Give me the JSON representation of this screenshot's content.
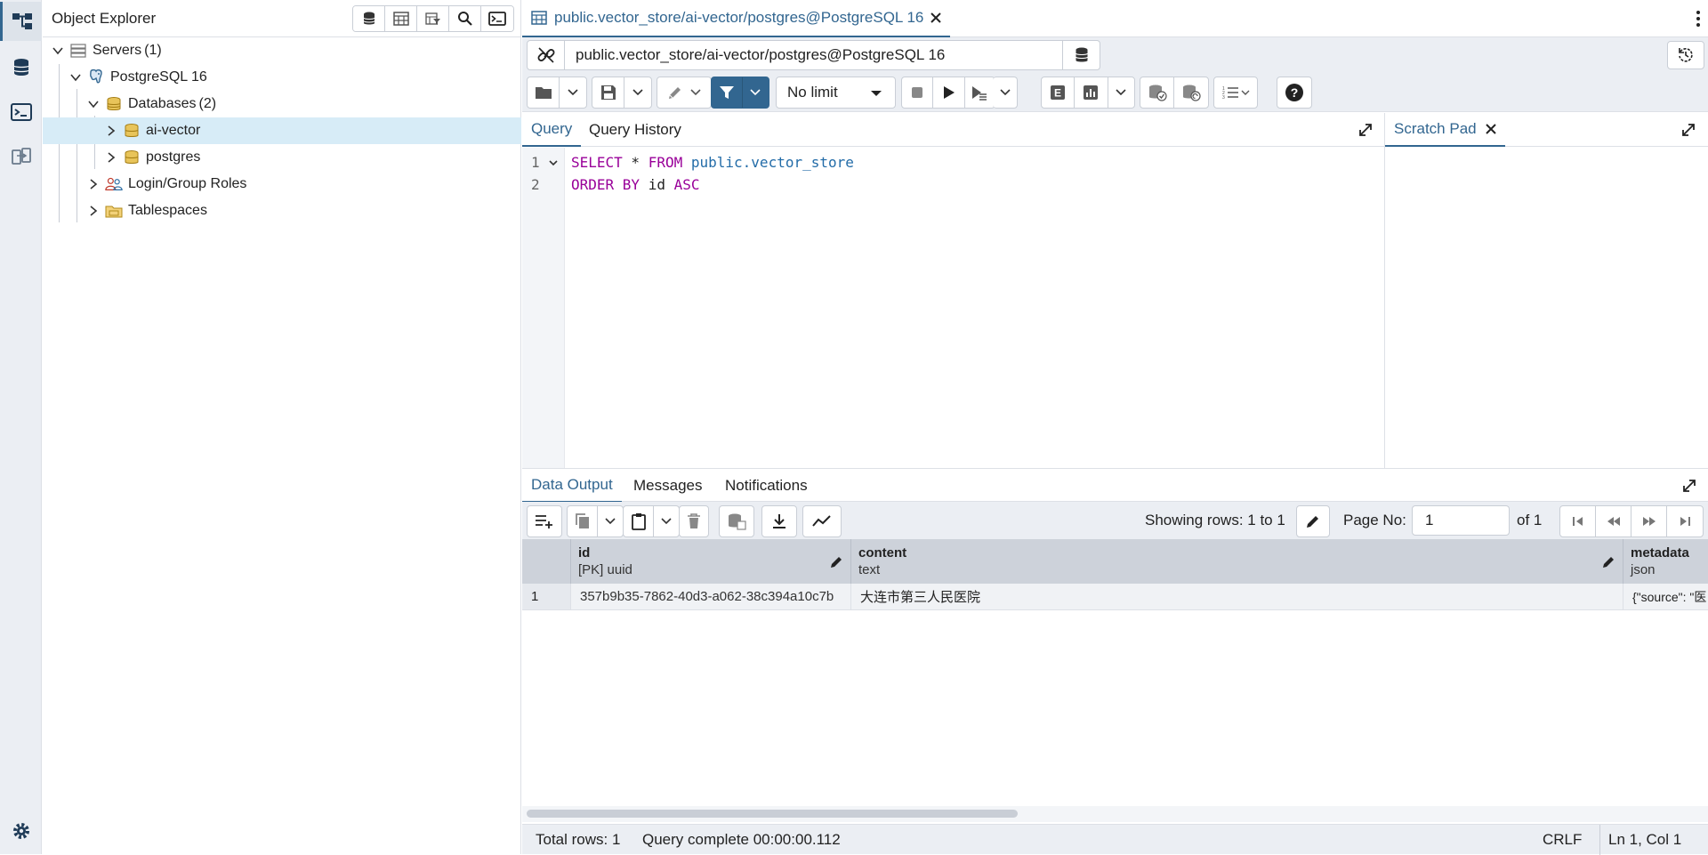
{
  "rail": {
    "items": [
      "object-explorer",
      "database",
      "terminal",
      "schema-diff",
      "settings"
    ]
  },
  "explorer": {
    "title": "Object Explorer",
    "tools": [
      "database-icon",
      "table-icon",
      "filter-table-icon",
      "search-icon",
      "terminal-icon"
    ],
    "tree": {
      "servers": "Servers",
      "servers_count": "(1)",
      "server": "PostgreSQL 16",
      "databases": "Databases",
      "databases_count": "(2)",
      "db1": "ai-vector",
      "db2": "postgres",
      "roles": "Login/Group Roles",
      "tablespaces": "Tablespaces"
    }
  },
  "main": {
    "tab_title": "public.vector_store/ai-vector/postgres@PostgreSQL 16",
    "connection": "public.vector_store/ai-vector/postgres@PostgreSQL 16",
    "limit": "No limit",
    "query_tabs": [
      "Query",
      "Query History"
    ],
    "scratch_pad": "Scratch Pad",
    "editor": {
      "line1_num": "1",
      "line2_num": "2",
      "line1": {
        "kw1": "SELECT",
        "star": " * ",
        "kw2": "FROM",
        "table": " public.vector_store"
      },
      "line2": {
        "kw1": "ORDER BY",
        "col": " id ",
        "kw2": "ASC"
      }
    },
    "output_tabs": [
      "Data Output",
      "Messages",
      "Notifications"
    ],
    "pagination": {
      "showing": "Showing rows: 1 to 1",
      "page_label": "Page No:",
      "page_value": "1",
      "of": "of 1"
    },
    "grid": {
      "columns": [
        {
          "name": "id",
          "type": "[PK] uuid"
        },
        {
          "name": "content",
          "type": "text"
        },
        {
          "name": "metadata",
          "type": "json"
        }
      ],
      "rows": [
        {
          "num": "1",
          "id": "357b9b35-7862-40d3-a062-38c394a10c7b",
          "content": "大连市第三人民医院",
          "metadata": "{\"source\": \"医"
        }
      ]
    },
    "status": {
      "total": "Total rows: 1",
      "query": "Query complete 00:00:00.112",
      "eol": "CRLF",
      "pos": "Ln 1, Col 1"
    }
  },
  "colors": {
    "accent": "#326690",
    "keyword": "#990099",
    "table_name": "#236ca8",
    "selected_row": "#d7ecf7"
  }
}
